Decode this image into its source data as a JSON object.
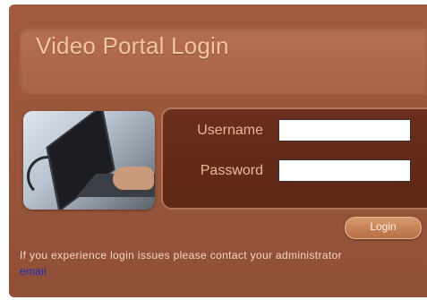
{
  "header": {
    "title": "Video Portal Login"
  },
  "photo": {
    "icon": "laptop-photo"
  },
  "form": {
    "username_label": "Username",
    "username_value": "",
    "password_label": "Password",
    "password_value": "",
    "login_label": "Login"
  },
  "footer": {
    "notice": "If you experience login issues please contact your administrator",
    "email_link": "email"
  },
  "colors": {
    "panel": "#98553b",
    "form_box": "#632a19",
    "title_text": "#f4c6a2",
    "link": "#1a2ac8"
  }
}
